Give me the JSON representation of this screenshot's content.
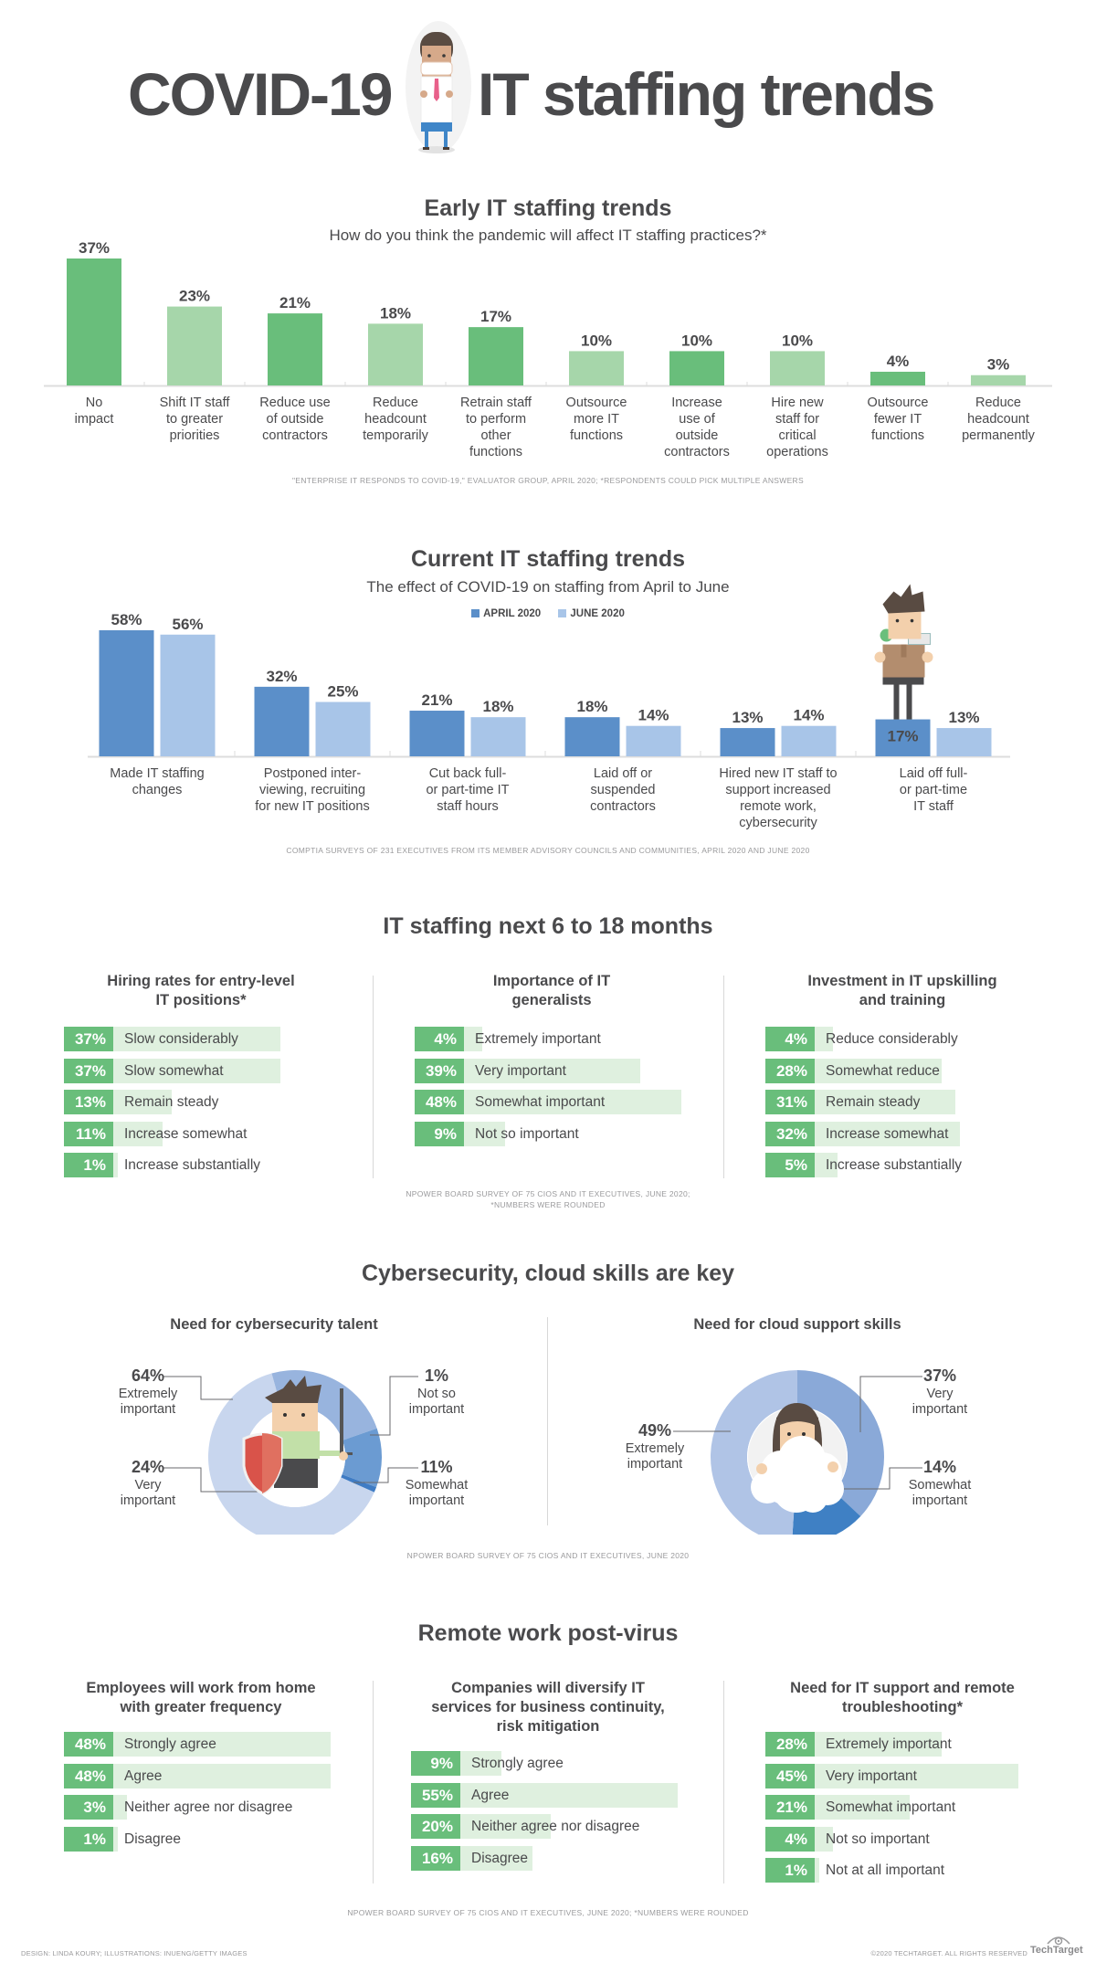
{
  "title": {
    "left": "COVID-19",
    "right": "IT staffing trends",
    "illustration": "masked-worker-illustration"
  },
  "early": {
    "heading": "Early IT staffing trends",
    "subtitle": "How do you think the pandemic will affect IT staffing practices?*",
    "footnote": "\"Enterprise IT responds to COVID-19,\" Evaluator Group, April 2020; *Respondents could pick multiple answers"
  },
  "current": {
    "heading": "Current IT staffing trends",
    "subtitle": "The effect of COVID-19 on staffing from April to June",
    "legend": [
      "APRIL 2020",
      "JUNE 2020"
    ],
    "footnote": "CompTIA surveys of 231 executives from its member advisory councils and communities, April 2020 and June 2020",
    "illustration": "laid-off-worker-with-box-illustration"
  },
  "next": {
    "heading": "IT staffing next 6 to 18 months",
    "footnote_lines": [
      "NPower board survey of 75 CIOs and IT executives, June 2020;",
      "*Numbers were rounded"
    ],
    "columns": [
      {
        "title_lines": [
          "Hiring rates for entry-level",
          "IT positions*"
        ],
        "rows": [
          {
            "pct": 37,
            "label": "Slow considerably"
          },
          {
            "pct": 37,
            "label": "Slow somewhat"
          },
          {
            "pct": 13,
            "label": "Remain steady"
          },
          {
            "pct": 11,
            "label": "Increase somewhat"
          },
          {
            "pct": 1,
            "label": "Increase substantially"
          }
        ]
      },
      {
        "title_lines": [
          "Importance of IT",
          "generalists"
        ],
        "rows": [
          {
            "pct": 4,
            "label": "Extremely important"
          },
          {
            "pct": 39,
            "label": "Very important"
          },
          {
            "pct": 48,
            "label": "Somewhat important"
          },
          {
            "pct": 9,
            "label": "Not so important"
          }
        ]
      },
      {
        "title_lines": [
          "Investment in IT upskilling",
          "and training"
        ],
        "rows": [
          {
            "pct": 4,
            "label": "Reduce considerably"
          },
          {
            "pct": 28,
            "label": "Somewhat reduce"
          },
          {
            "pct": 31,
            "label": "Remain steady"
          },
          {
            "pct": 32,
            "label": "Increase somewhat"
          },
          {
            "pct": 5,
            "label": "Increase substantially"
          }
        ]
      }
    ]
  },
  "skills": {
    "heading": "Cybersecurity, cloud skills are key",
    "footnote": "NPower board survey of 75 CIOs and IT executives, June 2020",
    "cyber": {
      "title": "Need for cybersecurity talent",
      "illustration": "knight-with-shield-and-sword-illustration"
    },
    "cloud": {
      "title": "Need for cloud support skills",
      "illustration": "woman-holding-cloud-illustration"
    }
  },
  "remote": {
    "heading": "Remote work post-virus",
    "footnote": "NPower board survey of 75 CIOs and IT executives, June 2020; *Numbers were rounded",
    "columns": [
      {
        "title_lines": [
          "Employees will work from home",
          "with greater frequency"
        ],
        "rows": [
          {
            "pct": 48,
            "label": "Strongly agree"
          },
          {
            "pct": 48,
            "label": "Agree"
          },
          {
            "pct": 3,
            "label": "Neither agree nor disagree"
          },
          {
            "pct": 1,
            "label": "Disagree"
          }
        ]
      },
      {
        "title_lines": [
          "Companies will diversify IT",
          "services for business continuity,",
          "risk mitigation"
        ],
        "rows": [
          {
            "pct": 9,
            "label": "Strongly agree"
          },
          {
            "pct": 55,
            "label": "Agree"
          },
          {
            "pct": 20,
            "label": "Neither agree nor disagree"
          },
          {
            "pct": 16,
            "label": "Disagree"
          }
        ]
      },
      {
        "title_lines": [
          "Need for IT support and remote",
          "troubleshooting*"
        ],
        "rows": [
          {
            "pct": 28,
            "label": "Extremely important"
          },
          {
            "pct": 45,
            "label": "Very important"
          },
          {
            "pct": 21,
            "label": "Somewhat important"
          },
          {
            "pct": 4,
            "label": "Not so important"
          },
          {
            "pct": 1,
            "label": "Not at all important"
          }
        ]
      }
    ]
  },
  "footer": {
    "credit": "Design: Linda Koury; Illustrations: inueng/Getty Images",
    "copyright": "©2020 TechTarget. All rights reserved",
    "brand": "TechTarget"
  },
  "colors": {
    "green_dark": "#69be7b",
    "green_light": "#a6d6aa",
    "green_track": "#dff0df",
    "blue_april": "#5b8fc9",
    "blue_june": "#a8c5e8",
    "text": "#4a4a4c"
  },
  "chart_data": [
    {
      "type": "bar",
      "title": "Early IT staffing trends",
      "subtitle": "How do you think the pandemic will affect IT staffing practices?*",
      "categories": [
        "No impact",
        "Shift IT staff to greater priorities",
        "Reduce use of outside contractors",
        "Reduce headcount temporarily",
        "Retrain staff to perform other functions",
        "Outsource more IT functions",
        "Increase use of outside contractors",
        "Hire new staff for critical operations",
        "Outsource fewer IT functions",
        "Reduce headcount permanently"
      ],
      "category_lines": [
        [
          "No",
          "impact"
        ],
        [
          "Shift IT staff",
          "to greater",
          "priorities"
        ],
        [
          "Reduce use",
          "of outside",
          "contractors"
        ],
        [
          "Reduce",
          "headcount",
          "temporarily"
        ],
        [
          "Retrain staff",
          "to perform",
          "other",
          "functions"
        ],
        [
          "Outsource",
          "more IT",
          "functions"
        ],
        [
          "Increase",
          "use of",
          "outside",
          "contractors"
        ],
        [
          "Hire new",
          "staff for",
          "critical",
          "operations"
        ],
        [
          "Outsource",
          "fewer IT",
          "functions"
        ],
        [
          "Reduce",
          "headcount",
          "permanently"
        ]
      ],
      "values": [
        37,
        23,
        21,
        18,
        17,
        10,
        10,
        10,
        4,
        3
      ],
      "unit": "%",
      "ylim": [
        0,
        37
      ],
      "xlabel": "",
      "ylabel": "",
      "grid": false
    },
    {
      "type": "bar",
      "title": "Current IT staffing trends",
      "subtitle": "The effect of COVID-19 on staffing from April to June",
      "categories": [
        "Made IT staffing changes",
        "Postponed inter-viewing, recruiting for new IT positions",
        "Cut back full- or part-time IT staff hours",
        "Laid off or suspended contractors",
        "Hired new IT staff to support increased remote work, cybersecurity",
        "Laid off full- or part-time IT staff"
      ],
      "category_lines": [
        [
          "Made IT staffing",
          "changes"
        ],
        [
          "Postponed inter-",
          "viewing, recruiting",
          "for new IT positions"
        ],
        [
          "Cut back full-",
          "or part-time IT",
          "staff hours"
        ],
        [
          "Laid off or",
          "suspended",
          "contractors"
        ],
        [
          "Hired new IT staff to",
          "support increased",
          "remote work,",
          "cybersecurity"
        ],
        [
          "Laid off full-",
          "or part-time",
          "IT staff"
        ]
      ],
      "series": [
        {
          "name": "APRIL 2020",
          "values": [
            58,
            32,
            21,
            18,
            13,
            17
          ]
        },
        {
          "name": "JUNE 2020",
          "values": [
            56,
            25,
            18,
            14,
            14,
            13
          ]
        }
      ],
      "unit": "%",
      "ylim": [
        0,
        58
      ],
      "legend": "top-center",
      "xlabel": "",
      "ylabel": "",
      "grid": false
    },
    {
      "type": "pie",
      "title": "Need for cybersecurity talent",
      "donut": true,
      "slices": [
        {
          "label": "Extremely important",
          "value": 64
        },
        {
          "label": "Very important",
          "value": 24
        },
        {
          "label": "Somewhat important",
          "value": 11
        },
        {
          "label": "Not so important",
          "value": 1
        }
      ],
      "unit": "%"
    },
    {
      "type": "pie",
      "title": "Need for cloud support skills",
      "donut": true,
      "slices": [
        {
          "label": "Very important",
          "value": 37
        },
        {
          "label": "Somewhat important",
          "value": 14
        },
        {
          "label": "Extremely important",
          "value": 49
        }
      ],
      "unit": "%"
    }
  ]
}
